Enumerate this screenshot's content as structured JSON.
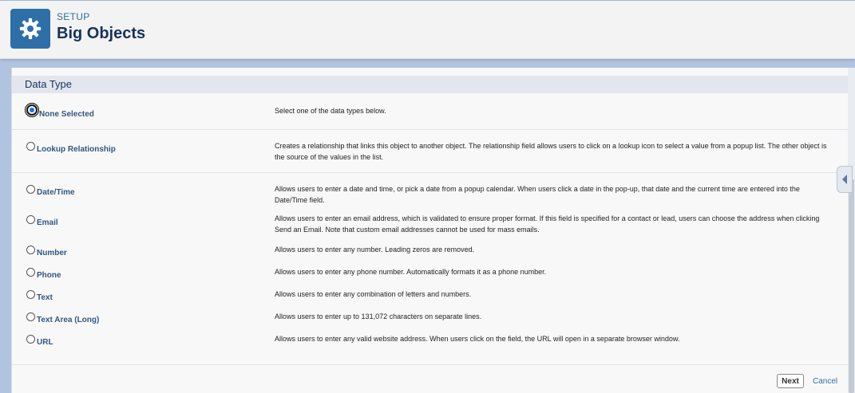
{
  "header": {
    "eyebrow": "SETUP",
    "title": "Big Objects",
    "icon": "gear-icon"
  },
  "section": {
    "title": "Data Type"
  },
  "options": [
    {
      "label": "None Selected",
      "selected": true,
      "description": "Select one of the data types below."
    },
    {
      "label": "Lookup Relationship",
      "selected": false,
      "description": "Creates a relationship that links this object to another object. The relationship field allows users to click on a lookup icon to select a value from a popup list. The other object is the source of the values in the list."
    },
    {
      "label": "Date/Time",
      "selected": false,
      "description": "Allows users to enter a date and time, or pick a date from a popup calendar. When users click a date in the pop-up, that date and the current time are entered into the Date/Time field."
    },
    {
      "label": "Email",
      "selected": false,
      "description": "Allows users to enter an email address, which is validated to ensure proper format. If this field is specified for a contact or lead, users can choose the address when clicking Send an Email. Note that custom email addresses cannot be used for mass emails."
    },
    {
      "label": "Number",
      "selected": false,
      "description": "Allows users to enter any number. Leading zeros are removed."
    },
    {
      "label": "Phone",
      "selected": false,
      "description": "Allows users to enter any phone number. Automatically formats it as a phone number."
    },
    {
      "label": "Text",
      "selected": false,
      "description": "Allows users to enter any combination of letters and numbers."
    },
    {
      "label": "Text Area (Long)",
      "selected": false,
      "description": "Allows users to enter up to 131,072 characters on separate lines."
    },
    {
      "label": "URL",
      "selected": false,
      "description": "Allows users to enter any valid website address. When users click on the field, the URL will open in a separate browser window."
    }
  ],
  "footer": {
    "next_label": "Next",
    "cancel_label": "Cancel"
  }
}
